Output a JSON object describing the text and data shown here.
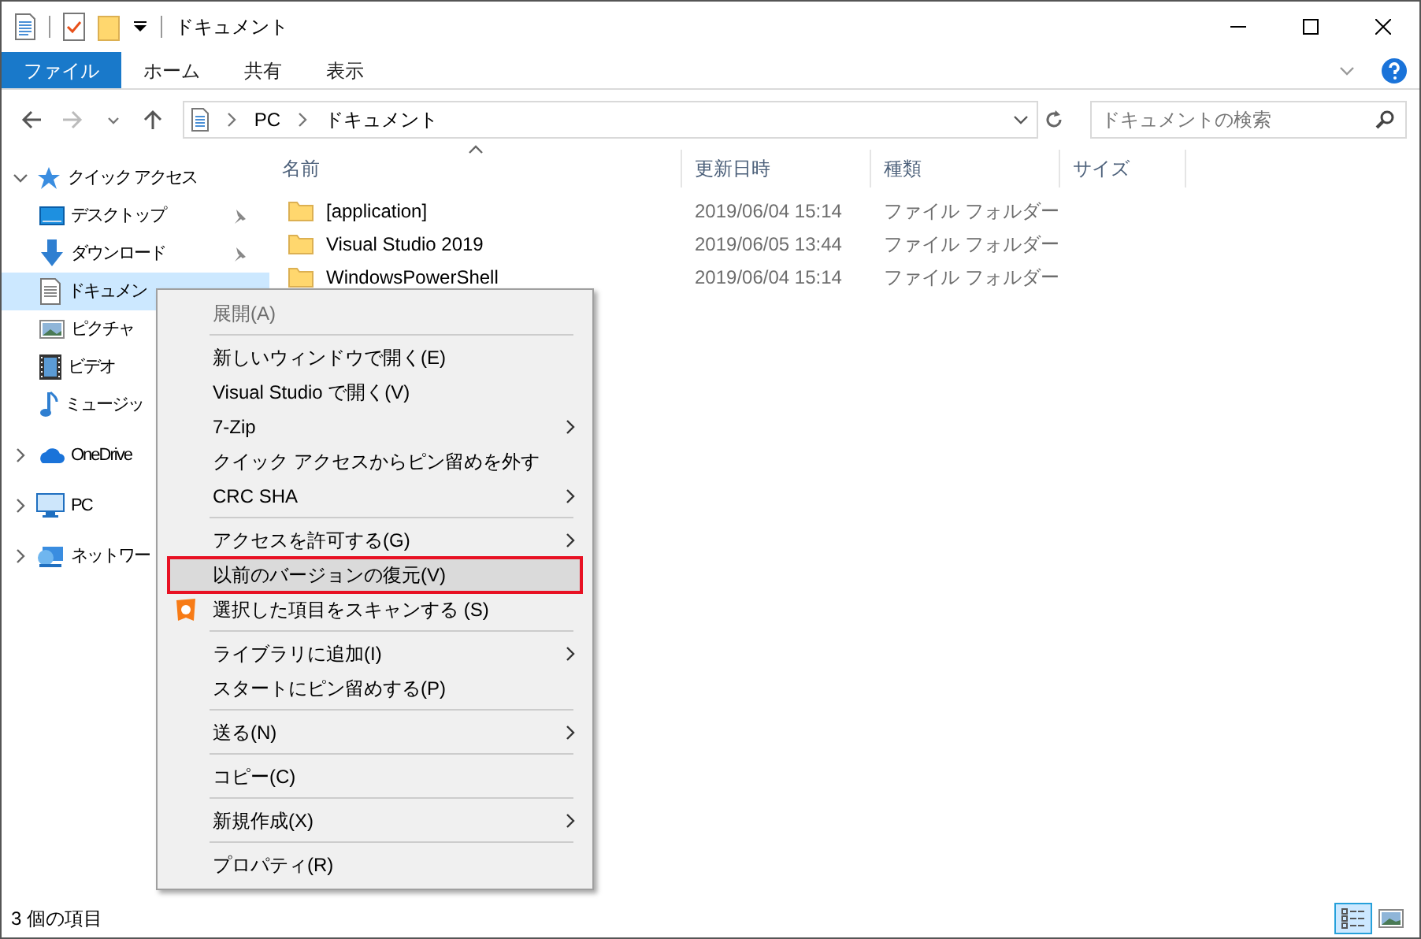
{
  "window": {
    "title": "ドキュメント"
  },
  "ribbon_tabs": [
    {
      "label": "ファイル",
      "selected": true
    },
    {
      "label": "ホーム",
      "selected": false
    },
    {
      "label": "共有",
      "selected": false
    },
    {
      "label": "表示",
      "selected": false
    }
  ],
  "address_bar": {
    "path": [
      "PC",
      "ドキュメント"
    ]
  },
  "search": {
    "placeholder": "ドキュメントの検索"
  },
  "sidebar": {
    "items": [
      {
        "label": "クイック アクセス",
        "kind": "star",
        "expanded": true,
        "selected": false,
        "children": [
          {
            "label": "デスクトップ",
            "kind": "desktop",
            "pinned": true,
            "selected": false
          },
          {
            "label": "ダウンロード",
            "kind": "download",
            "pinned": true,
            "selected": false
          },
          {
            "label": "ドキュメン",
            "kind": "document",
            "pinned": false,
            "selected": true
          },
          {
            "label": "ピクチャ",
            "kind": "picture",
            "pinned": false,
            "selected": false
          },
          {
            "label": "ビデオ",
            "kind": "video",
            "pinned": false,
            "selected": false
          },
          {
            "label": "ミュージッ",
            "kind": "music",
            "pinned": false,
            "selected": false
          }
        ]
      },
      {
        "label": "OneDrive",
        "kind": "cloud",
        "expanded": false,
        "selected": false
      },
      {
        "label": "PC",
        "kind": "pc",
        "expanded": false,
        "selected": false
      },
      {
        "label": "ネットワー",
        "kind": "network",
        "expanded": false,
        "selected": false
      }
    ]
  },
  "table": {
    "columns": [
      {
        "label": "名前",
        "sorted": true
      },
      {
        "label": "更新日時",
        "sorted": false
      },
      {
        "label": "種類",
        "sorted": false
      },
      {
        "label": "サイズ",
        "sorted": false
      }
    ],
    "rows": [
      {
        "name": "[application]",
        "modified": "2019/06/04 15:14",
        "type": "ファイル フォルダー"
      },
      {
        "name": "Visual Studio 2019",
        "modified": "2019/06/05 13:44",
        "type": "ファイル フォルダー"
      },
      {
        "name": "WindowsPowerShell",
        "modified": "2019/06/04 15:14",
        "type": "ファイル フォルダー"
      }
    ]
  },
  "context_menu": {
    "items": [
      {
        "kind": "item",
        "label": "展開(A)",
        "disabled": true,
        "submenu": false,
        "highlighted": false
      },
      {
        "kind": "separator"
      },
      {
        "kind": "item",
        "label": "新しいウィンドウで開く(E)",
        "disabled": false,
        "submenu": false,
        "highlighted": false
      },
      {
        "kind": "item",
        "label": "Visual Studio で開く(V)",
        "disabled": false,
        "submenu": false,
        "highlighted": false
      },
      {
        "kind": "item",
        "label": "7-Zip",
        "disabled": false,
        "submenu": true,
        "highlighted": false
      },
      {
        "kind": "item",
        "label": "クイック アクセスからピン留めを外す",
        "disabled": false,
        "submenu": false,
        "highlighted": false
      },
      {
        "kind": "item",
        "label": "CRC SHA",
        "disabled": false,
        "submenu": true,
        "highlighted": false
      },
      {
        "kind": "separator"
      },
      {
        "kind": "item",
        "label": "アクセスを許可する(G)",
        "disabled": false,
        "submenu": true,
        "highlighted": false
      },
      {
        "kind": "item",
        "label": "以前のバージョンの復元(V)",
        "disabled": false,
        "submenu": false,
        "highlighted": true
      },
      {
        "kind": "scan",
        "label": "選択した項目をスキャンする (S)",
        "disabled": false,
        "submenu": false,
        "highlighted": false
      },
      {
        "kind": "separator"
      },
      {
        "kind": "item",
        "label": "ライブラリに追加(I)",
        "disabled": false,
        "submenu": true,
        "highlighted": false
      },
      {
        "kind": "item",
        "label": "スタートにピン留めする(P)",
        "disabled": false,
        "submenu": false,
        "highlighted": false
      },
      {
        "kind": "separator"
      },
      {
        "kind": "item",
        "label": "送る(N)",
        "disabled": false,
        "submenu": true,
        "highlighted": false
      },
      {
        "kind": "separator"
      },
      {
        "kind": "item",
        "label": "コピー(C)",
        "disabled": false,
        "submenu": false,
        "highlighted": false
      },
      {
        "kind": "separator"
      },
      {
        "kind": "item",
        "label": "新規作成(X)",
        "disabled": false,
        "submenu": true,
        "highlighted": false
      },
      {
        "kind": "separator"
      },
      {
        "kind": "item",
        "label": "プロパティ(R)",
        "disabled": false,
        "submenu": false,
        "highlighted": false
      }
    ]
  },
  "status_bar": {
    "text": "3 個の項目",
    "views": [
      {
        "kind": "details",
        "selected": true
      },
      {
        "kind": "large-icons",
        "selected": false
      }
    ]
  }
}
